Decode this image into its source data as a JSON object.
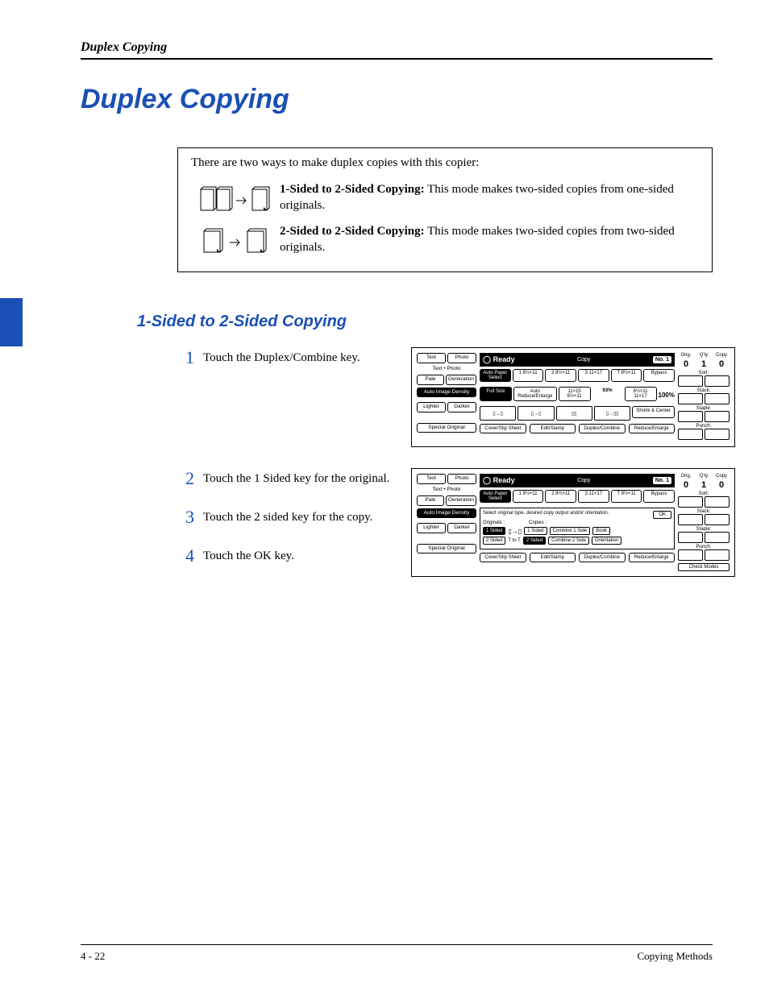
{
  "running_head": "Duplex Copying",
  "main_title": "Duplex Copying",
  "intro_line": "There are two ways to make duplex copies with this copier:",
  "mode1": {
    "title": "1-Sided to 2-Sided Copying:",
    "desc": " This mode makes two-sided copies from one-sided originals."
  },
  "mode2": {
    "title": "2-Sided to 2-Sided Copying:",
    "desc": " This mode makes two-sided copies from two-sided originals."
  },
  "section_title": "1-Sided to 2-Sided Copying",
  "steps": {
    "s1": {
      "num": "1",
      "text": "Touch the Duplex/Combine key."
    },
    "s2": {
      "num": "2",
      "text": "Touch the 1 Sided key for the original."
    },
    "s3": {
      "num": "3",
      "text": "Touch the 2 sided key for the copy."
    },
    "s4": {
      "num": "4",
      "text": "Touch the OK key."
    }
  },
  "screen": {
    "ready": "Ready",
    "copy_label": "Copy",
    "no1": "No. 1",
    "left": {
      "text": "Text",
      "photo": "Photo",
      "text_photo": "Text • Photo",
      "pale": "Pale",
      "generation": "Generation",
      "auto_density": "Auto Image Density",
      "lighter": "Lighter",
      "darker": "Darker",
      "special": "Special Original"
    },
    "paper": {
      "auto_paper": "Auto Paper Select",
      "t1": "8½×11",
      "t2": "8½×11",
      "t3": "11×17",
      "t4": "8½×11",
      "bypass": "Bypass"
    },
    "size": {
      "full": "Full Size",
      "auto_re": "Auto Reduce/Enlarge",
      "a": "11×15 8½×11",
      "pct": "93%",
      "b": "8½×11 11×17",
      "hundred": "100%",
      "shrink": "Shrink & Center"
    },
    "bottom": {
      "cover": "Cover/Slip Sheet",
      "edit": "Edit/Stamp",
      "duplex": "Duplex/Combine",
      "reduce": "Reduce/Enlarge"
    },
    "right": {
      "orig": "Orig.",
      "qty": "Q'ty",
      "copy": "Copy",
      "zero": "0",
      "one": "1",
      "sort": "Sort:",
      "stack": "Stack:",
      "staple": "Staple:",
      "punch": "Punch:",
      "check": "Check Modes"
    },
    "duplex_panel": {
      "hint": "Select original type, desired copy output and/or orientation.",
      "originals": "Originals :",
      "copies": "Copies :",
      "ok": "OK",
      "one_sided": "1 Sided",
      "two_sided": "2 Sided",
      "ttot": "T to T",
      "combine1": "Combine 1 Side",
      "combine2": "Combine 2 Side",
      "book": "Book",
      "orientation": "Orientation"
    }
  },
  "footer": {
    "left": "4 - 22",
    "right": "Copying Methods"
  }
}
